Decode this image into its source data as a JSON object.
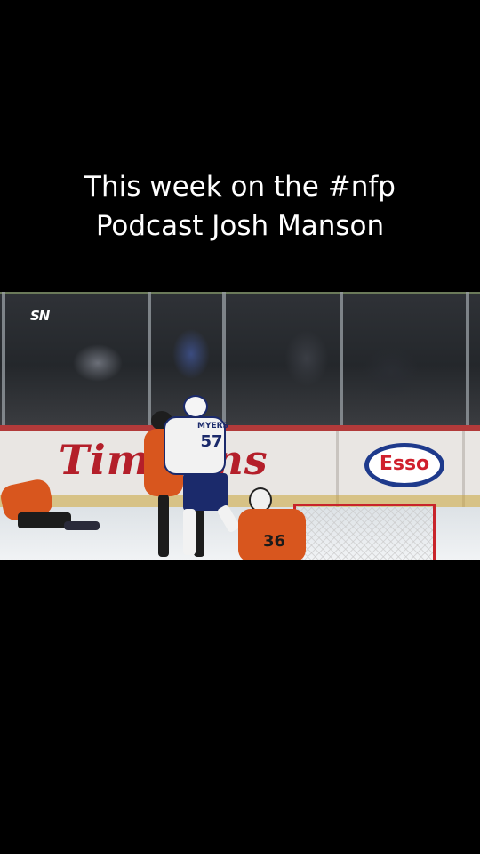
{
  "caption": {
    "line1": "This week on the #nfp",
    "line2": "Podcast Josh Manson"
  },
  "video": {
    "broadcaster_logo": "SN",
    "ad_left_text": "Tim tons",
    "ad_right_text": "Esso",
    "player_white": {
      "name": "MYERS",
      "number": "57"
    },
    "player_goalie": {
      "number": "36"
    }
  },
  "colors": {
    "background": "#000000",
    "caption_text": "#ffffff",
    "tim_red": "#b41f2a",
    "esso_blue": "#1e3a8c",
    "ducks_orange": "#d8561e"
  }
}
